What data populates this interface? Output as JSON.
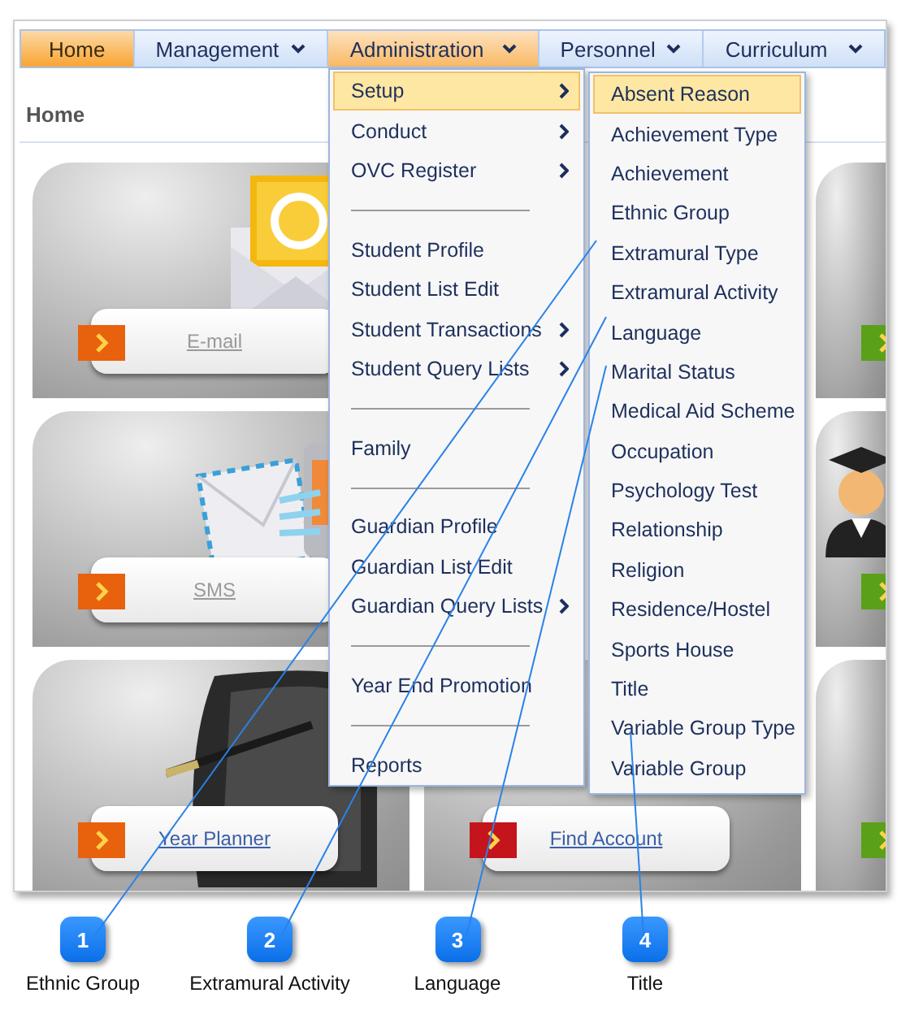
{
  "nav": [
    {
      "label": "Home",
      "selected": true,
      "expanded": false,
      "has_menu": false
    },
    {
      "label": "Management",
      "selected": false,
      "expanded": false,
      "has_menu": true
    },
    {
      "label": "Administration",
      "selected": false,
      "expanded": true,
      "has_menu": true
    },
    {
      "label": "Personnel",
      "selected": false,
      "expanded": false,
      "has_menu": true
    },
    {
      "label": "Curriculum",
      "selected": false,
      "expanded": false,
      "has_menu": true
    }
  ],
  "breadcrumb": {
    "title": "Home"
  },
  "tile_columns": [
    {
      "tiles": [
        {
          "label": "E-mail",
          "color": "#e8620e",
          "disabled": true
        },
        {
          "label": "SMS",
          "color": "#e8620e",
          "disabled": true
        },
        {
          "label": "Year Planner",
          "color": "#e8620e",
          "disabled": false
        }
      ]
    },
    {
      "tiles": [
        {
          "label": "Find Account",
          "color": "#c4141c",
          "disabled": false
        }
      ]
    },
    {
      "tiles": [
        {
          "color": "#5aa018"
        },
        {
          "color": "#5aa018"
        },
        {
          "color": "#5aa018"
        }
      ]
    }
  ],
  "menu": {
    "items": [
      {
        "kind": "item",
        "label": "Setup",
        "has_submenu": true,
        "selected": true
      },
      {
        "kind": "item",
        "label": "Conduct",
        "has_submenu": true,
        "selected": false
      },
      {
        "kind": "item",
        "label": "OVC Register",
        "has_submenu": true,
        "selected": false
      },
      {
        "kind": "separator"
      },
      {
        "kind": "item",
        "label": "Student Profile",
        "has_submenu": false,
        "selected": false
      },
      {
        "kind": "item",
        "label": "Student List Edit",
        "has_submenu": false,
        "selected": false
      },
      {
        "kind": "item",
        "label": "Student Transactions",
        "has_submenu": true,
        "selected": false
      },
      {
        "kind": "item",
        "label": "Student Query Lists",
        "has_submenu": true,
        "selected": false
      },
      {
        "kind": "separator"
      },
      {
        "kind": "item",
        "label": "Family",
        "has_submenu": false,
        "selected": false
      },
      {
        "kind": "separator"
      },
      {
        "kind": "item",
        "label": "Guardian Profile",
        "has_submenu": false,
        "selected": false
      },
      {
        "kind": "item",
        "label": "Guardian List Edit",
        "has_submenu": false,
        "selected": false
      },
      {
        "kind": "item",
        "label": "Guardian Query Lists",
        "has_submenu": true,
        "selected": false
      },
      {
        "kind": "separator"
      },
      {
        "kind": "item",
        "label": "Year End Promotion",
        "has_submenu": false,
        "selected": false
      },
      {
        "kind": "separator"
      },
      {
        "kind": "item",
        "label": "Reports",
        "has_submenu": false,
        "selected": false
      }
    ]
  },
  "submenu": {
    "items": [
      {
        "label": "Absent Reason",
        "selected": true
      },
      {
        "label": "Achievement Type",
        "selected": false
      },
      {
        "label": "Achievement",
        "selected": false
      },
      {
        "label": "Ethnic Group",
        "selected": false
      },
      {
        "label": "Extramural Type",
        "selected": false
      },
      {
        "label": "Extramural Activity",
        "selected": false
      },
      {
        "label": "Language",
        "selected": false
      },
      {
        "label": "Marital Status",
        "selected": false
      },
      {
        "label": "Medical Aid Scheme",
        "selected": false
      },
      {
        "label": "Occupation",
        "selected": false
      },
      {
        "label": "Psychology Test",
        "selected": false
      },
      {
        "label": "Relationship",
        "selected": false
      },
      {
        "label": "Religion",
        "selected": false
      },
      {
        "label": "Residence/Hostel",
        "selected": false
      },
      {
        "label": "Sports House",
        "selected": false
      },
      {
        "label": "Title",
        "selected": false
      },
      {
        "label": "Variable Group Type",
        "selected": false
      },
      {
        "label": "Variable Group",
        "selected": false
      }
    ]
  },
  "callouts": [
    {
      "number": "1",
      "label": "Ethnic Group"
    },
    {
      "number": "2",
      "label": "Extramural Activity"
    },
    {
      "number": "3",
      "label": "Language"
    },
    {
      "number": "4",
      "label": "Title"
    }
  ]
}
